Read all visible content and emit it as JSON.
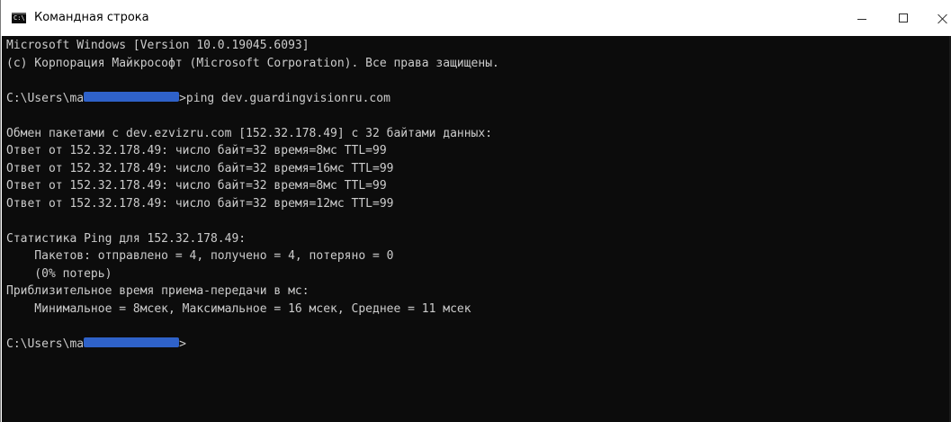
{
  "window": {
    "title": "Командная строка",
    "icon": "cmd-console-icon",
    "icon_label": "C:\\",
    "controls": {
      "minimize_icon": "minimize-icon",
      "maximize_icon": "maximize-icon",
      "close_icon": "close-icon"
    }
  },
  "console": {
    "background": "#0c0c0c",
    "foreground": "#cccccc",
    "redaction_color": "#2f62c9",
    "lines": [
      {
        "text": "Microsoft Windows [Version 10.0.19045.6093]"
      },
      {
        "text": "(c) Корпорация Майкрософт (Microsoft Corporation). Все права защищены."
      },
      {
        "text": ""
      },
      {
        "prefix": "C:\\Users\\mа",
        "redacted": true,
        "suffix": ">ping dev.guardingvisionru.com"
      },
      {
        "text": ""
      },
      {
        "text": "Обмен пакетами с dev.ezvizru.com [152.32.178.49] с 32 байтами данных:"
      },
      {
        "text": "Ответ от 152.32.178.49: число байт=32 время=8мс TTL=99"
      },
      {
        "text": "Ответ от 152.32.178.49: число байт=32 время=16мс TTL=99"
      },
      {
        "text": "Ответ от 152.32.178.49: число байт=32 время=8мс TTL=99"
      },
      {
        "text": "Ответ от 152.32.178.49: число байт=32 время=12мс TTL=99"
      },
      {
        "text": ""
      },
      {
        "text": "Статистика Ping для 152.32.178.49:"
      },
      {
        "text": "    Пакетов: отправлено = 4, получено = 4, потеряно = 0"
      },
      {
        "text": "    (0% потерь)"
      },
      {
        "text": "Приблизительное время приема-передачи в мс:"
      },
      {
        "text": "    Минимальное = 8мсек, Максимальное = 16 мсек, Среднее = 11 мсек"
      },
      {
        "text": ""
      },
      {
        "prefix": "C:\\Users\\mа",
        "redacted": true,
        "suffix": ">"
      }
    ]
  }
}
